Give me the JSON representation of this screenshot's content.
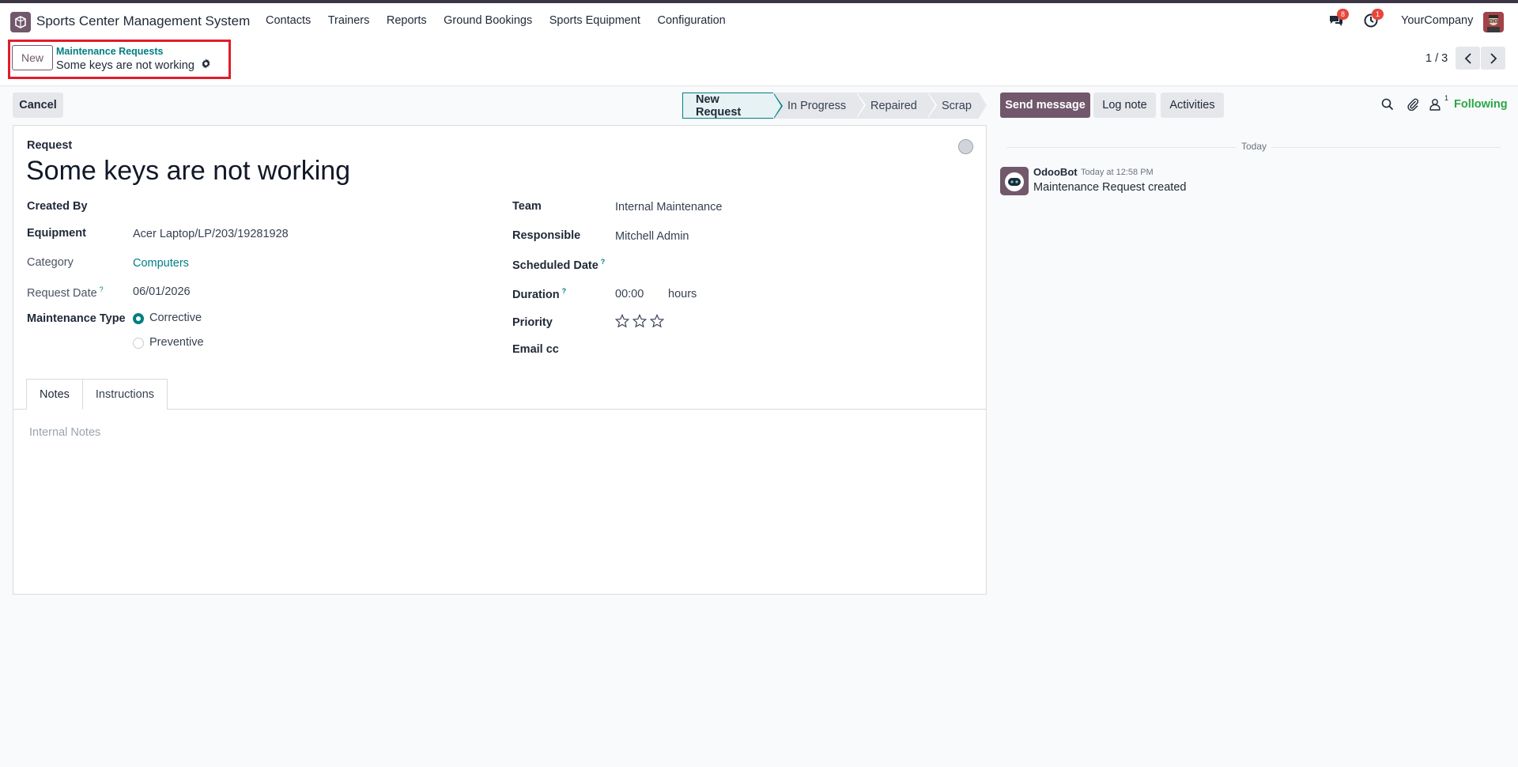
{
  "navbar": {
    "app_name": "Sports Center Management System",
    "menu": [
      "Contacts",
      "Trainers",
      "Reports",
      "Ground Bookings",
      "Sports Equipment",
      "Configuration"
    ],
    "messages_badge": "8",
    "activities_badge": "1",
    "company": "YourCompany"
  },
  "control": {
    "new_label": "New",
    "breadcrumb_parent": "Maintenance Requests",
    "breadcrumb_current": "Some keys are not working",
    "pager": "1 / 3"
  },
  "actions": {
    "cancel_label": "Cancel",
    "stages": [
      "New Request",
      "In Progress",
      "Repaired",
      "Scrap"
    ],
    "active_stage": "New Request"
  },
  "form": {
    "request_label": "Request",
    "title": "Some keys are not working",
    "left": {
      "created_by_label": "Created By",
      "created_by": "",
      "equipment_label": "Equipment",
      "equipment": "Acer Laptop/LP/203/19281928",
      "category_label": "Category",
      "category": "Computers",
      "request_date_label": "Request Date",
      "request_date": "06/01/2026",
      "maintenance_type_label": "Maintenance Type",
      "maintenance_options": [
        "Corrective",
        "Preventive"
      ],
      "maintenance_selected": "Corrective"
    },
    "right": {
      "team_label": "Team",
      "team": "Internal Maintenance",
      "responsible_label": "Responsible",
      "responsible": "Mitchell Admin",
      "scheduled_date_label": "Scheduled Date",
      "duration_label": "Duration",
      "duration": "00:00",
      "duration_unit": "hours",
      "priority_label": "Priority",
      "priority_stars": 0,
      "priority_max": 3,
      "email_cc_label": "Email cc"
    },
    "help_mark": "?",
    "tabs": [
      "Notes",
      "Instructions"
    ],
    "active_tab": "Notes",
    "notes_placeholder": "Internal Notes"
  },
  "chatter": {
    "send_message": "Send message",
    "log_note": "Log note",
    "activities": "Activities",
    "followers_count": "1",
    "following": "Following",
    "date_separator": "Today",
    "messages": [
      {
        "author": "OdooBot",
        "time": "Today at 12:58 PM",
        "body": "Maintenance Request created"
      }
    ]
  },
  "colors": {
    "brand": "#71586b",
    "accent": "#017e84",
    "highlight": "#e11d2b",
    "following": "#28a745"
  }
}
